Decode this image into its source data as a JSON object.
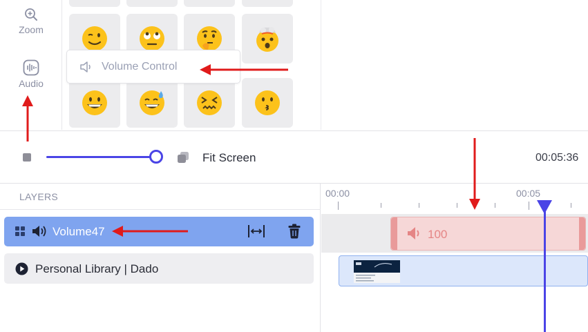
{
  "tools": {
    "zoom_label": "Zoom",
    "audio_label": "Audio"
  },
  "emoji_panel": {
    "emojis": [
      "winking-face",
      "face-with-rolling-eyes",
      "thinking-face",
      "exploding-head",
      "grinning-face",
      "grinning-face-with-sweat",
      "confounded-face",
      "kissing-face"
    ]
  },
  "tooltip": {
    "label": "Volume Control",
    "icon": "speaker-icon"
  },
  "zoom_bar": {
    "fit_label": "Fit Screen",
    "timecode": "00:05:36",
    "zoom_level": 1.0
  },
  "layers": {
    "title": "LAYERS",
    "items": [
      {
        "label": "Volume47",
        "type": "audio",
        "active": true
      },
      {
        "label": "Personal Library | Dado",
        "type": "video",
        "active": false
      }
    ]
  },
  "timeline": {
    "ruler_labels": [
      "00:00",
      "00:05"
    ],
    "audio_clip_value": "100"
  },
  "colors": {
    "accent": "#4a44e6",
    "active_layer": "#7fa4ef",
    "annotation_arrow": "#e01b1b",
    "audio_clip": "#f6d7d7"
  }
}
